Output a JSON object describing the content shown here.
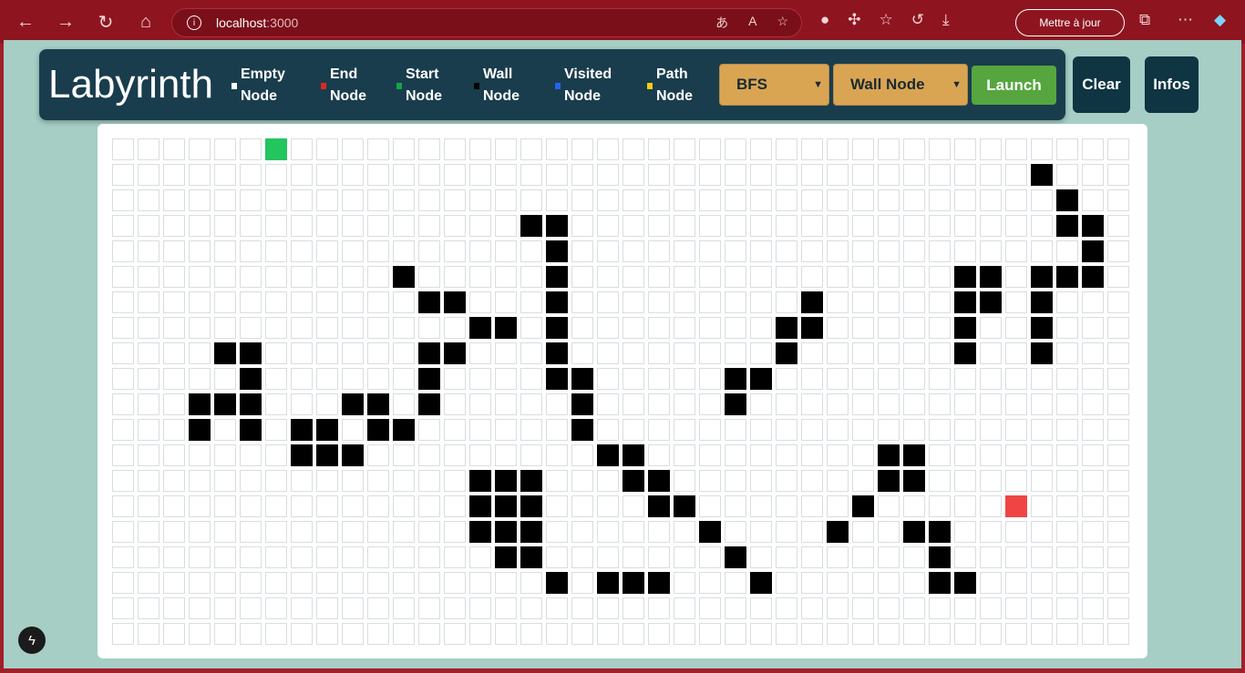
{
  "browser": {
    "url_host": "localhost",
    "url_port": ":3000",
    "update_label": "Mettre à jour"
  },
  "header": {
    "title": "Labyrinth",
    "legend": [
      {
        "line1": "Empty",
        "line2": "Node",
        "color": "#ffffff"
      },
      {
        "line1": "End",
        "line2": "Node",
        "color": "#dc2626"
      },
      {
        "line1": "Start",
        "line2": "Node",
        "color": "#16a34a"
      },
      {
        "line1": "Wall",
        "line2": "Node",
        "color": "#000000"
      },
      {
        "line1": "Visited",
        "line2": "Node",
        "color": "#2563eb"
      },
      {
        "line1": "Path",
        "line2": "Node",
        "color": "#facc15"
      }
    ],
    "algorithm_select": "BFS",
    "node_select": "Wall Node",
    "launch_label": "Launch",
    "clear_label": "Clear",
    "infos_label": "Infos"
  },
  "grid": {
    "cols": 40,
    "rows": 20,
    "start": [
      0,
      6
    ],
    "end": [
      14,
      35
    ],
    "walls": {
      "1": [
        36
      ],
      "2": [
        37
      ],
      "3": [
        16,
        17,
        37,
        38
      ],
      "4": [
        17,
        38
      ],
      "5": [
        11,
        17,
        33,
        34,
        36,
        37,
        38
      ],
      "6": [
        12,
        13,
        17,
        27,
        33,
        34,
        36
      ],
      "7": [
        14,
        15,
        17,
        26,
        27,
        33,
        36
      ],
      "8": [
        4,
        5,
        12,
        13,
        17,
        26,
        33,
        36
      ],
      "9": [
        5,
        12,
        17,
        18,
        24,
        25
      ],
      "10": [
        3,
        4,
        5,
        9,
        10,
        12,
        18,
        24
      ],
      "11": [
        3,
        5,
        7,
        8,
        10,
        11,
        18
      ],
      "12": [
        7,
        8,
        9,
        19,
        20,
        30,
        31
      ],
      "13": [
        14,
        15,
        16,
        20,
        21,
        30,
        31
      ],
      "14": [
        14,
        15,
        16,
        21,
        22,
        29
      ],
      "15": [
        14,
        15,
        16,
        23,
        28,
        31,
        32
      ],
      "16": [
        15,
        16,
        24,
        32
      ],
      "17": [
        17,
        19,
        20,
        21,
        25,
        32,
        33
      ]
    }
  }
}
